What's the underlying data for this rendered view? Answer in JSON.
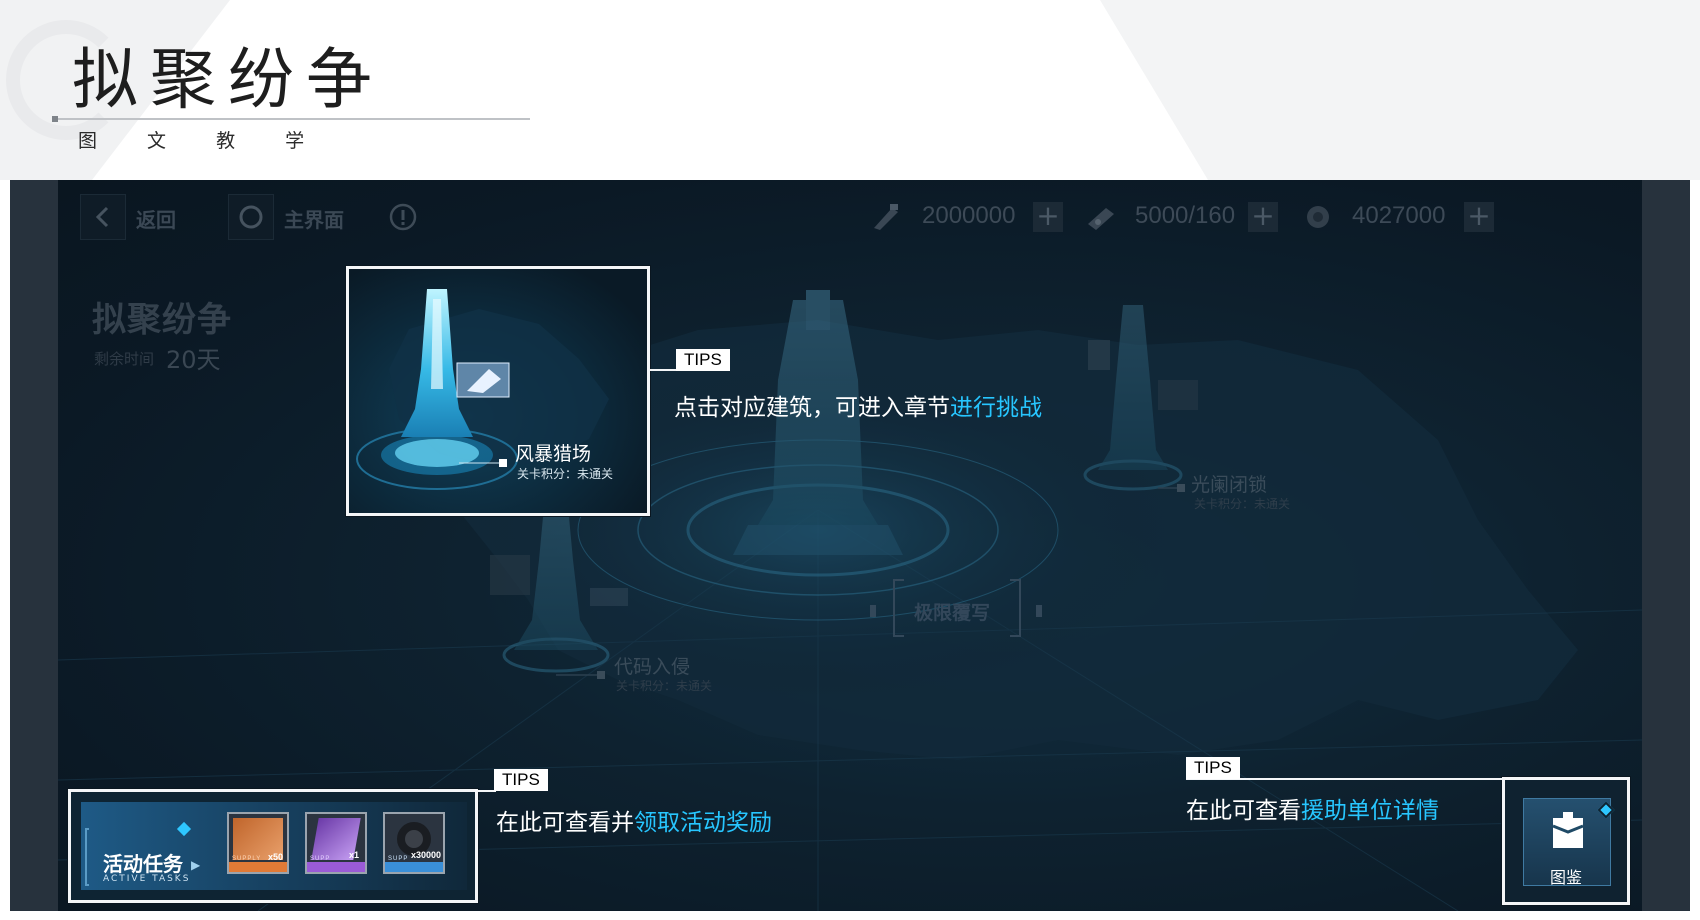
{
  "header": {
    "title": "拟聚纷争",
    "subtitle": "图 文 教 学"
  },
  "topbar": {
    "back_label": "返回",
    "home_label": "主界面",
    "resources": [
      {
        "icon": "ammo-icon",
        "value": "2000000"
      },
      {
        "icon": "battery-icon",
        "value": "5000/160"
      },
      {
        "icon": "gear-part-icon",
        "value": "4027000"
      }
    ]
  },
  "event": {
    "title": "拟聚纷争",
    "remain_label": "剩余时间",
    "remain_value": "20天"
  },
  "buildings": [
    {
      "name": "风暴猎场",
      "score": "关卡积分：未通关"
    },
    {
      "name": "光阑闭锁",
      "score": "关卡积分：未通关"
    },
    {
      "name": "代码入侵",
      "score": "关卡积分：未通关"
    },
    {
      "name": "极限覆写"
    }
  ],
  "tasks": {
    "title": "活动任务",
    "subtitle": "ACTIVE TASKS",
    "rewards": [
      {
        "label": "SUPPLY",
        "count": "x50",
        "color": "#e07a36"
      },
      {
        "label": "SUPP",
        "count": "x1",
        "color": "#9a5bd6"
      },
      {
        "label": "SUPP",
        "count": "x30000",
        "color": "#3a8fd8"
      }
    ]
  },
  "codex": {
    "label": "图鉴"
  },
  "tips": [
    {
      "tag": "TIPS",
      "text": "点击对应建筑，可进入章节",
      "highlight": "进行挑战"
    },
    {
      "tag": "TIPS",
      "text": "在此可查看并",
      "highlight": "领取活动奖励"
    },
    {
      "tag": "TIPS",
      "text": "在此可查看",
      "highlight": "援助单位详情"
    }
  ],
  "colors": {
    "accent": "#27c6ff",
    "background": "#0b1925",
    "frame": "#27323d"
  }
}
